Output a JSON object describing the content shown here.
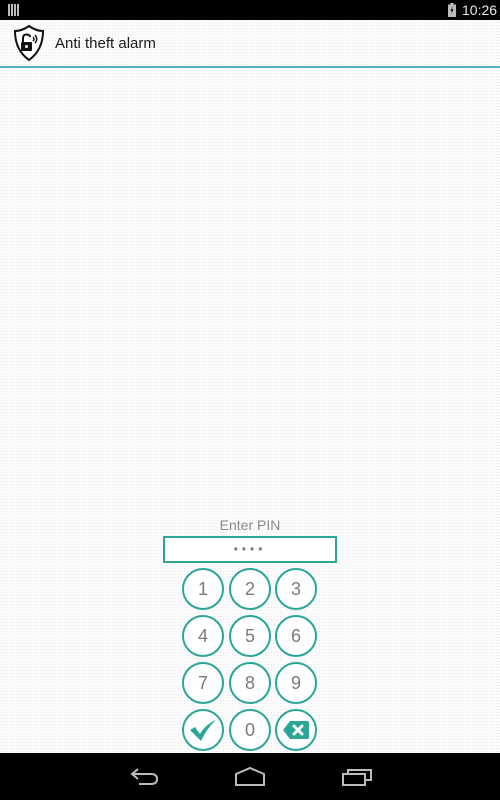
{
  "status_bar": {
    "time": "10:26",
    "notification_icon": "notification-icon",
    "battery_icon": "battery-charging-icon"
  },
  "action_bar": {
    "app_icon": "shield-lock-icon",
    "title": "Anti theft alarm"
  },
  "pin_entry": {
    "label": "Enter PIN",
    "value": "••••"
  },
  "keypad": {
    "keys": [
      "1",
      "2",
      "3",
      "4",
      "5",
      "6",
      "7",
      "8",
      "9"
    ],
    "confirm_icon": "checkmark-icon",
    "zero": "0",
    "delete_icon": "backspace-icon"
  },
  "colors": {
    "accent": "#2aa598",
    "header_line": "#4bb3cf"
  },
  "nav_bar": {
    "back_icon": "back-icon",
    "home_icon": "home-icon",
    "recents_icon": "recents-icon"
  }
}
